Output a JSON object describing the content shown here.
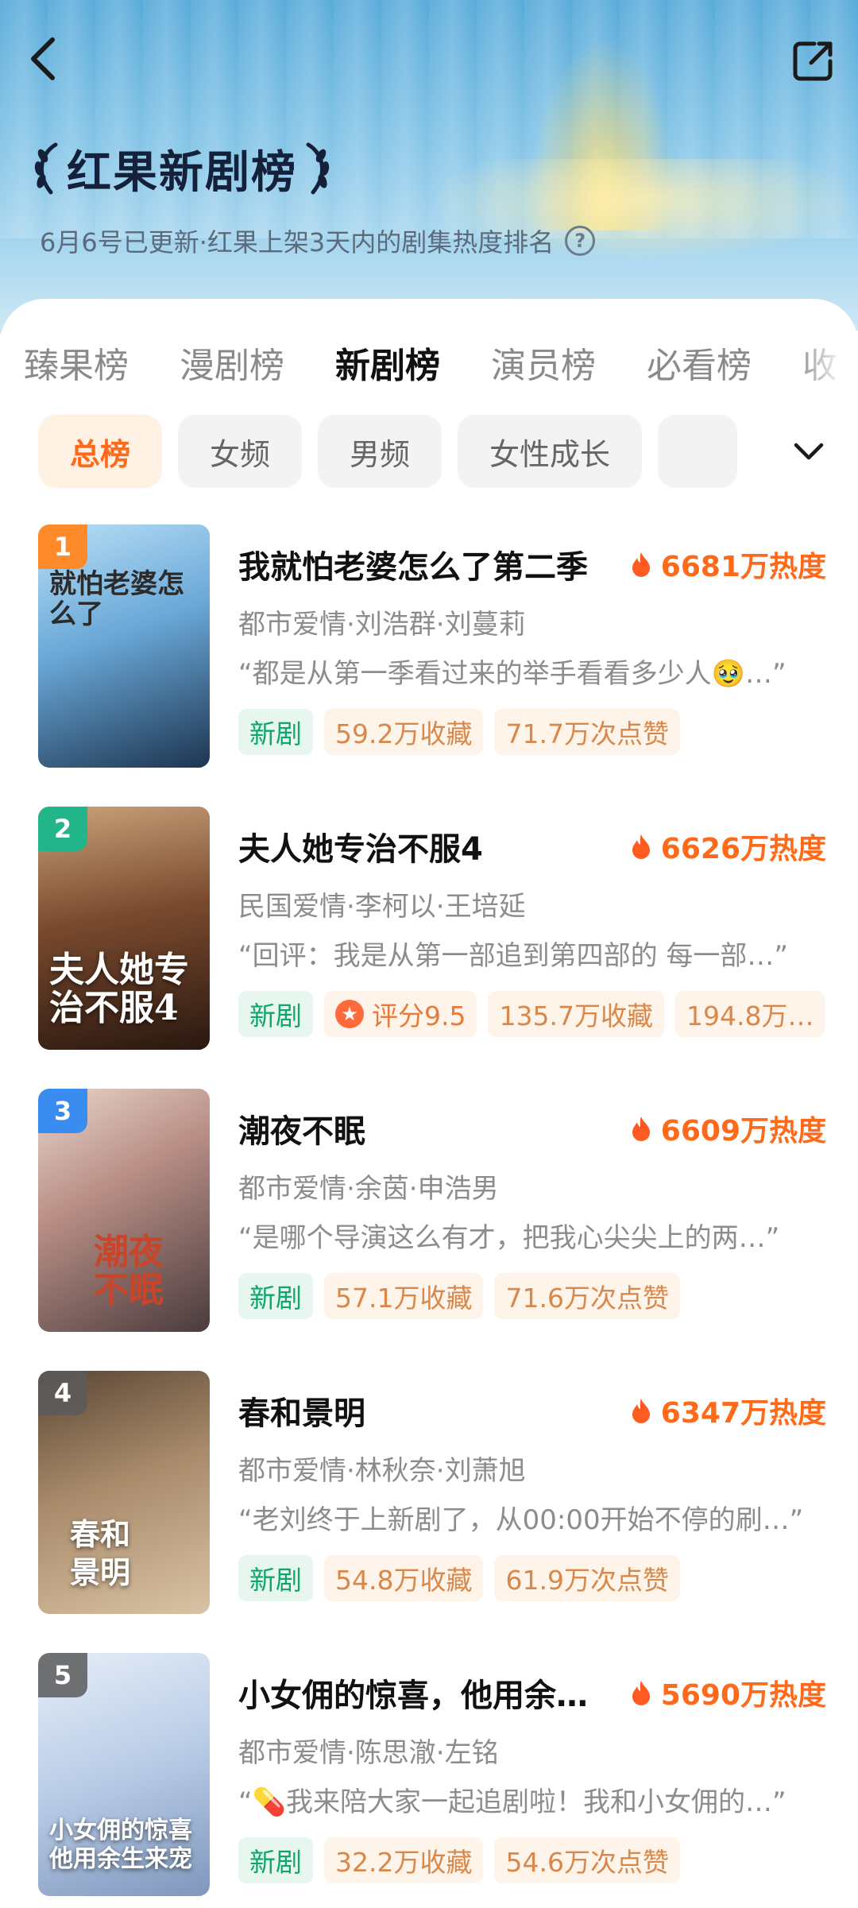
{
  "header": {
    "title": "红果新剧榜",
    "subtitle": "6月6号已更新·红果上架3天内的剧集热度排名",
    "help_symbol": "?"
  },
  "tabs": [
    "臻果榜",
    "漫剧榜",
    "新剧榜",
    "演员榜",
    "必看榜",
    "收"
  ],
  "active_tab": "新剧榜",
  "filters": [
    "总榜",
    "女频",
    "男频",
    "女性成长"
  ],
  "active_filter": "总榜",
  "colors": {
    "accent": "#ff6a1a",
    "new_green": "#11a56b",
    "rank1": "#ff8a2a",
    "rank2": "#22b58a",
    "rank3": "#3b8cf0",
    "rank_other": "#7a7a7a"
  },
  "items": [
    {
      "rank": "1",
      "title": "我就怕老婆怎么了第二季",
      "heat": "6681万热度",
      "meta": "都市爱情·刘浩群·刘蔓莉",
      "quote": "“都是从第一季看过来的举手看看多少人🥹…”",
      "badge_new": "新剧",
      "stats": [
        "59.2万收藏",
        "71.7万次点赞"
      ],
      "poster_text": "就怕老婆怎么了"
    },
    {
      "rank": "2",
      "title": "夫人她专治不服4",
      "heat": "6626万热度",
      "meta": "民国爱情·李柯以·王培延",
      "quote": "“回评：我是从第一部追到第四部的 每一部…”",
      "badge_new": "新剧",
      "score": "评分9.5",
      "stats": [
        "135.7万收藏",
        "194.8万…"
      ],
      "poster_text": "夫人她专治不服4"
    },
    {
      "rank": "3",
      "title": "潮夜不眠",
      "heat": "6609万热度",
      "meta": "都市爱情·余茵·申浩男",
      "quote": "“是哪个导演这么有才，把我心尖尖上的两…”",
      "badge_new": "新剧",
      "stats": [
        "57.1万收藏",
        "71.6万次点赞"
      ],
      "poster_text": "潮夜不眠"
    },
    {
      "rank": "4",
      "title": "春和景明",
      "heat": "6347万热度",
      "meta": "都市爱情·林秋奈·刘萧旭",
      "quote": "“老刘终于上新剧了，从00:00开始不停的刷…”",
      "badge_new": "新剧",
      "stats": [
        "54.8万收藏",
        "61.9万次点赞"
      ],
      "poster_text": "春和景明"
    },
    {
      "rank": "5",
      "title": "小女佣的惊喜，他用余…",
      "heat": "5690万热度",
      "meta": "都市爱情·陈思澈·左铭",
      "quote": "“💊我来陪大家一起追剧啦！我和小女佣的…”",
      "badge_new": "新剧",
      "stats": [
        "32.2万收藏",
        "54.6万次点赞"
      ],
      "poster_text": "小女佣的惊喜 他用余生来宠"
    }
  ]
}
